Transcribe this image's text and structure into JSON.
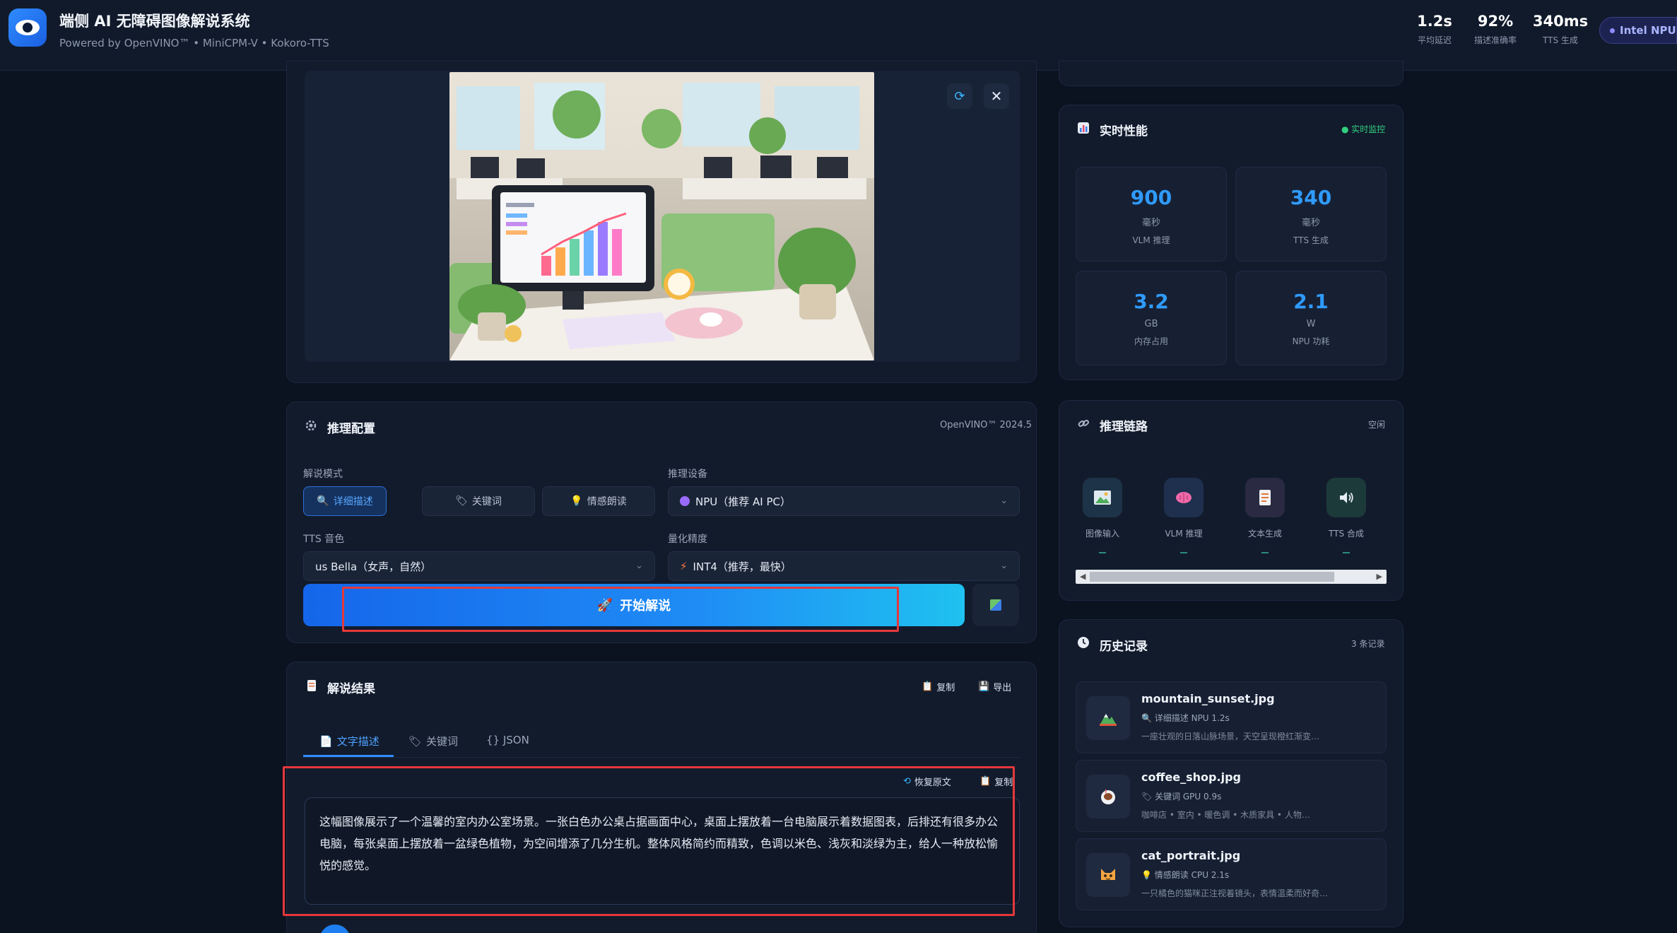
{
  "header": {
    "title": "端侧 AI 无障碍图像解说系统",
    "subtitle": "Powered by OpenVINO™ • MiniCPM-V • Kokoro-TTS",
    "stats": [
      {
        "value": "1.2s",
        "label": "平均延迟"
      },
      {
        "value": "92%",
        "label": "描述准确率"
      },
      {
        "value": "340ms",
        "label": "TTS 生成"
      }
    ],
    "device_badge": "Intel NPU"
  },
  "image_panel": {
    "refresh_icon": "refresh-icon",
    "close_icon": "close-icon"
  },
  "config": {
    "title": "推理配置",
    "version": "OpenVINO™ 2024.5",
    "mode_label": "解说模式",
    "modes": [
      "详细描述",
      "关键词",
      "情感朗读"
    ],
    "device_label": "推理设备",
    "device_value": "NPU（推荐 AI PC）",
    "tts_label": "TTS 音色",
    "tts_value": "us Bella（女声，自然）",
    "precision_label": "量化精度",
    "precision_value": "INT4（推荐，最快）",
    "start_button": "开始解说"
  },
  "result": {
    "title": "解说结果",
    "copy_label": "复制",
    "export_label": "导出",
    "tabs": [
      "文字描述",
      "关键词",
      "{} JSON"
    ],
    "restore_label": "恢复原文",
    "copy_label_2": "复制",
    "text": "这幅图像展示了一个温馨的室内办公室场景。一张白色办公桌占据画面中心，桌面上摆放着一台电脑展示着数据图表，后排还有很多办公电脑，每张桌面上摆放着一盆绿色植物，为空间增添了几分生机。整体风格简约而精致，色调以米色、浅灰和淡绿为主，给人一种放松愉悦的感觉。"
  },
  "performance": {
    "title": "实时性能",
    "live_label": "● 实时监控",
    "metrics": [
      {
        "value": "900",
        "unit": "毫秒",
        "label": "VLM 推理"
      },
      {
        "value": "340",
        "unit": "毫秒",
        "label": "TTS 生成"
      },
      {
        "value": "3.2",
        "unit": "GB",
        "label": "内存占用"
      },
      {
        "value": "2.1",
        "unit": "W",
        "label": "NPU 功耗"
      }
    ]
  },
  "pipeline": {
    "title": "推理链路",
    "status": "空闲",
    "steps": [
      {
        "label": "图像输入",
        "icon": "image-icon"
      },
      {
        "label": "VLM 推理",
        "icon": "brain-icon"
      },
      {
        "label": "文本生成",
        "icon": "document-icon"
      },
      {
        "label": "TTS 合成",
        "icon": "speaker-icon"
      }
    ]
  },
  "history": {
    "title": "历史记录",
    "count": "3 条记录",
    "items": [
      {
        "name": "mountain_sunset.jpg",
        "meta": "详细描述   NPU   1.2s",
        "desc": "一座壮观的日落山脉场景，天空呈现橙红渐变…",
        "icon": "mountain-icon"
      },
      {
        "name": "coffee_shop.jpg",
        "meta": "关键词   GPU   0.9s",
        "desc": "咖啡店 • 室内 • 暖色调 • 木质家具 • 人物…",
        "icon": "coffee-icon"
      },
      {
        "name": "cat_portrait.jpg",
        "meta": "情感朗读   CPU   2.1s",
        "desc": "一只橘色的猫咪正注视着镜头，表情温柔而好奇…",
        "icon": "cat-icon"
      }
    ]
  },
  "colors": {
    "background": "#0b1220",
    "panel": "#121b2c",
    "accent": "#2f8cff",
    "highlight": "#e5383b"
  }
}
